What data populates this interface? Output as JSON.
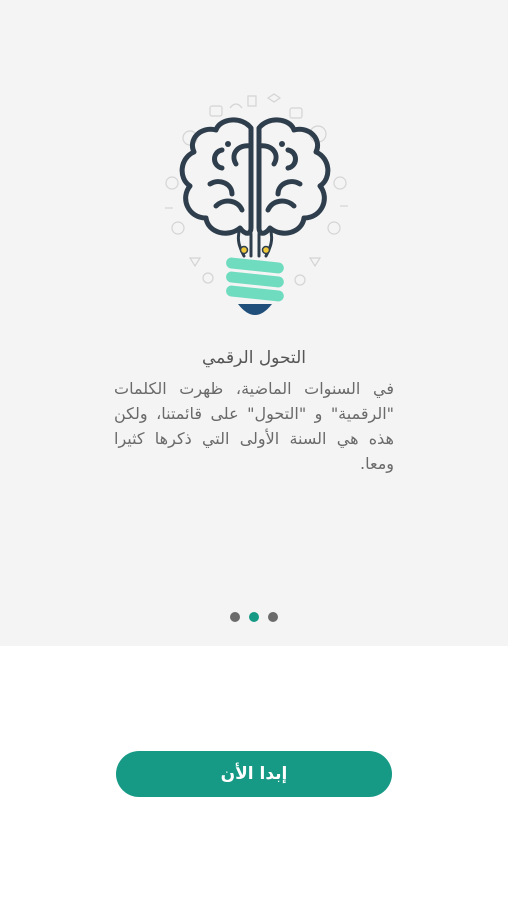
{
  "onboarding": {
    "illustration_icon": "brain-lightbulb-icon",
    "title": "التحول الرقمي",
    "body": "في السنوات الماضية، ظهرت الكلمات \"الرقمية\" و \"التحول\" على قائمتنا، ولكن هذه هي السنة الأولى التي ذكرها كثيرا ومعا.",
    "pagination": {
      "total": 3,
      "active": 2
    }
  },
  "actions": {
    "start_label": "إبدا الأن"
  },
  "colors": {
    "accent": "#179a85",
    "bulb_glass": "#6fdcbf",
    "brain_outline": "#2f3e4c",
    "bulb_base": "#1f4f7a"
  }
}
